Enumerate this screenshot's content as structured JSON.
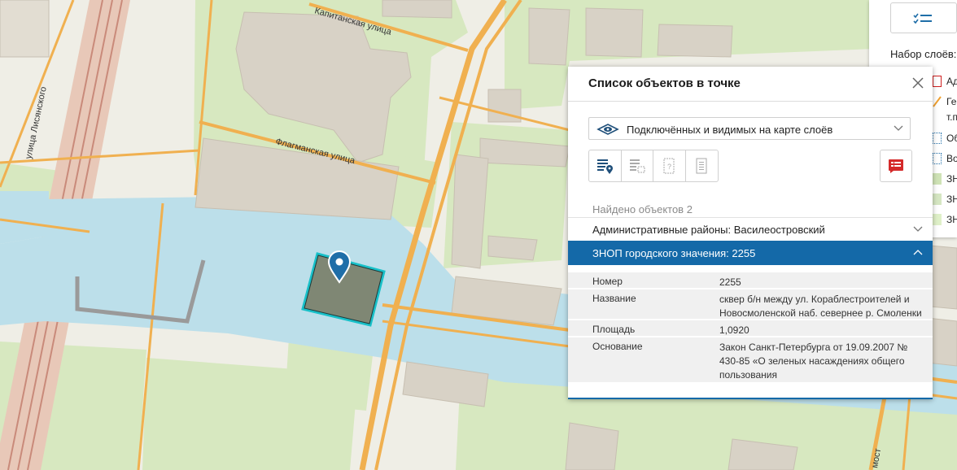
{
  "map": {
    "streets": {
      "kapitanskaya": "Капитанская улица",
      "flagmanskaya": "Флагманская улица",
      "lisyanskogo": "улица Лисянского",
      "most": "мост"
    }
  },
  "popup": {
    "title": "Список объектов в точке",
    "layer_select": "Подключённых и видимых на карте слоёв",
    "found": "Найдено объектов 2",
    "items": [
      {
        "label": "Административные районы: Василеостровский"
      },
      {
        "label": "ЗНОП городского значения: 2255"
      }
    ],
    "attributes": [
      {
        "key": "Номер",
        "lines": [
          "2255"
        ]
      },
      {
        "key": "Название",
        "lines": [
          "сквер б/н между ул. Кораблестроителей и",
          "Новосмоленской наб. севернее р. Смоленки"
        ]
      },
      {
        "key": "Площадь",
        "lines": [
          "1,0920"
        ]
      },
      {
        "key": "Основание",
        "lines": [
          "Закон Санкт-Петербурга от 19.09.2007 №",
          "430-85 «О зеленых насаждениях общего",
          "пользования"
        ]
      }
    ]
  },
  "side_panel": {
    "layers_title": "Набор слоёв:",
    "items": [
      "Ад",
      "Ге",
      "т.п",
      "Об",
      "Во",
      "ЗН",
      "ЗН",
      "ЗН"
    ]
  },
  "colors": {
    "water": "#bcdfea",
    "green": "#d7e8c0",
    "building": "#d8d2c6",
    "road": "#f0b050",
    "selected_fill": "#7f8774",
    "selected_stroke": "#18c0c8",
    "header_blue": "#1469a8",
    "marker": "#1f6ea8"
  }
}
